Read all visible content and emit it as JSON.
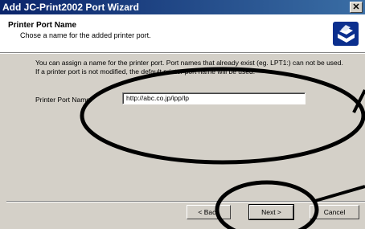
{
  "window": {
    "title": "Add JC-Print2002 Port Wizard",
    "close_glyph": "✕"
  },
  "header": {
    "title": "Printer Port Name",
    "subtitle": "Chose a name for the added printer port.",
    "icon": "printer-wizard-icon"
  },
  "content": {
    "description_line1": "You can assign a name for the printer port. Port names that already exist (eg. LPT1:) can not be used.",
    "description_line2": "If a printer port is not modified, the default printer port name will be used.",
    "port_label": "Printer Port Name:",
    "port_value": "http://abc.co.jp/ipp/lp"
  },
  "buttons": {
    "back": "< Back",
    "next": "Next >",
    "cancel": "Cancel"
  },
  "colors": {
    "title_bar": "#0a246a",
    "face": "#d4d0c8",
    "annotation": "#000000"
  }
}
